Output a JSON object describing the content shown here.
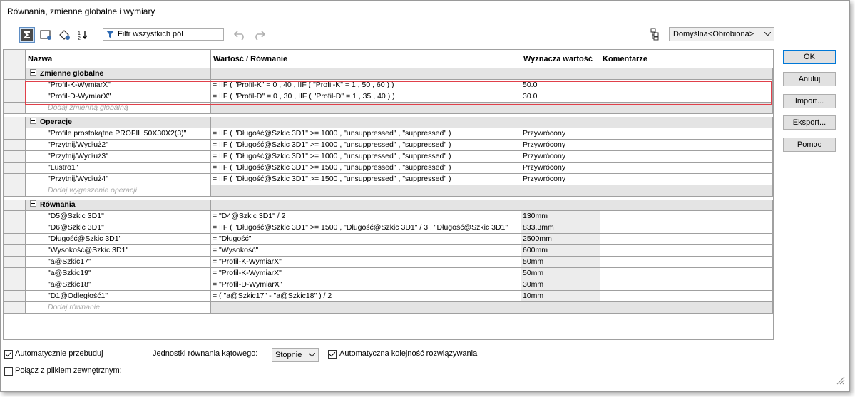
{
  "window": {
    "title": "Równania, zmienne globalne i wymiary"
  },
  "toolbar": {
    "filter_placeholder": "Filtr wszystkich pól",
    "config_value": "Domyślna<Obrobiona>"
  },
  "columns": [
    "Nazwa",
    "Wartość / Równanie",
    "Wyznacza wartość",
    "Komentarze"
  ],
  "groups": {
    "global": {
      "title": "Zmienne globalne",
      "rows": [
        {
          "name": "\"Profil-K-WymiarX\"",
          "value": "= IIF ( \"Profil-K\" = 0 , 40 , IIF ( \"Profil-K\" = 1 , 50 , 60 ) )",
          "result": "50.0",
          "comment": ""
        },
        {
          "name": "\"Profil-D-WymiarX\"",
          "value": "= IIF ( \"Profil-D\" = 0 , 30 , IIF ( \"Profil-D\" = 1 , 35 , 40 ) )",
          "result": "30.0",
          "comment": ""
        }
      ],
      "add_label": "Dodaj zmienną globalną"
    },
    "ops": {
      "title": "Operacje",
      "rows": [
        {
          "name": "\"Profile prostokątne PROFIL 50X30X2(3)\"",
          "value": "= IIF ( \"Długość@Szkic 3D1\" >= 1000 , \"unsuppressed\" , \"suppressed\" )",
          "result": "Przywrócony",
          "comment": ""
        },
        {
          "name": "\"Przytnij/Wydłuż2\"",
          "value": "= IIF ( \"Długość@Szkic 3D1\" >= 1000 , \"unsuppressed\" , \"suppressed\" )",
          "result": "Przywrócony",
          "comment": ""
        },
        {
          "name": "\"Przytnij/Wydłuż3\"",
          "value": "= IIF ( \"Długość@Szkic 3D1\" >= 1000 , \"unsuppressed\" , \"suppressed\" )",
          "result": "Przywrócony",
          "comment": ""
        },
        {
          "name": "\"Lustro1\"",
          "value": "= IIF ( \"Długość@Szkic 3D1\" >= 1500 , \"unsuppressed\" , \"suppressed\" )",
          "result": "Przywrócony",
          "comment": ""
        },
        {
          "name": "\"Przytnij/Wydłuż4\"",
          "value": "= IIF ( \"Długość@Szkic 3D1\" >= 1500 , \"unsuppressed\" , \"suppressed\" )",
          "result": "Przywrócony",
          "comment": ""
        }
      ],
      "add_label": "Dodaj wygaszenie operacji"
    },
    "equations": {
      "title": "Równania",
      "rows": [
        {
          "name": "\"D5@Szkic 3D1\"",
          "value": "= \"D4@Szkic 3D1\" / 2",
          "result": "130mm",
          "comment": ""
        },
        {
          "name": "\"D6@Szkic 3D1\"",
          "value": "= IIF ( \"Długość@Szkic 3D1\" >= 1500 , \"Długość@Szkic 3D1\" / 3 , \"Długość@Szkic 3D1\"",
          "result": "833.3mm",
          "comment": ""
        },
        {
          "name": "\"Długość@Szkic 3D1\"",
          "value": "= \"Długość\"",
          "result": "2500mm",
          "comment": ""
        },
        {
          "name": "\"Wysokość@Szkic 3D1\"",
          "value": "= \"Wysokość\"",
          "result": "600mm",
          "comment": ""
        },
        {
          "name": "\"a@Szkic17\"",
          "value": "= \"Profil-K-WymiarX\"",
          "result": "50mm",
          "comment": ""
        },
        {
          "name": "\"a@Szkic19\"",
          "value": "= \"Profil-K-WymiarX\"",
          "result": "50mm",
          "comment": ""
        },
        {
          "name": "\"a@Szkic18\"",
          "value": "= \"Profil-D-WymiarX\"",
          "result": "30mm",
          "comment": ""
        },
        {
          "name": "\"D1@Odległość1\"",
          "value": "= ( \"a@Szkic17\" - \"a@Szkic18\" ) / 2",
          "result": "10mm",
          "comment": ""
        }
      ],
      "add_label": "Dodaj równanie"
    }
  },
  "buttons": {
    "ok": "OK",
    "cancel": "Anuluj",
    "import": "Import...",
    "export": "Eksport...",
    "help": "Pomoc"
  },
  "bottom": {
    "auto_rebuild": "Automatycznie przebuduj",
    "auto_rebuild_checked": true,
    "angle_units_label": "Jednostki równania kątowego:",
    "angle_units_value": "Stopnie",
    "auto_order": "Automatyczna kolejność rozwiązywania",
    "auto_order_checked": true,
    "link_file": "Połącz z plikiem zewnętrznym:",
    "link_file_checked": false
  },
  "colors": {
    "highlight": "#e0404a",
    "group_bg": "#e4e4e4",
    "accent": "#0078d7"
  }
}
